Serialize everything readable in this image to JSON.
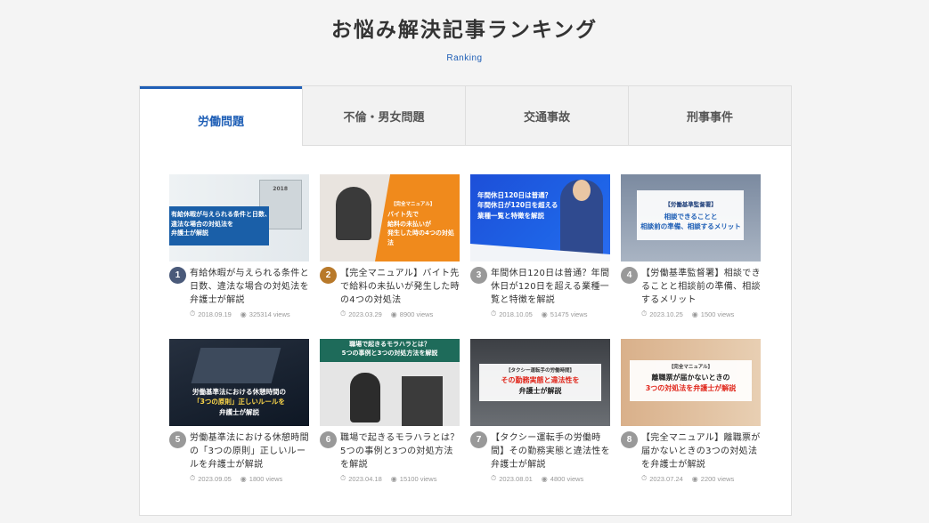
{
  "heading": {
    "title": "お悩み解決記事ランキング",
    "subtitle": "Ranking"
  },
  "tabs": [
    {
      "label": "労働問題",
      "active": true
    },
    {
      "label": "不倫・男女問題",
      "active": false
    },
    {
      "label": "交通事故",
      "active": false
    },
    {
      "label": "刑事事件",
      "active": false
    }
  ],
  "articles": [
    {
      "rank": "1",
      "title": "有給休暇が与えられる条件と日数、違法な場合の対処法を弁護士が解説",
      "date": "2018.09.19",
      "views": "325314 views",
      "thumb_lines": [
        "有給休暇が与えられる条件と日数、",
        "違法な場合の対処法を",
        "弁護士が解説"
      ],
      "thumb_tag": "2018"
    },
    {
      "rank": "2",
      "title": "【完全マニュアル】バイト先で給料の未払いが発生した時の4つの対処法",
      "date": "2023.03.29",
      "views": "8900 views",
      "thumb_lines": [
        "バイト先で",
        "給料の未払いが",
        "発生した時の4つの対処法"
      ],
      "thumb_tag": "【完全マニュアル】"
    },
    {
      "rank": "3",
      "title": "年間休日120日は普通？年間休日が120日を超える業種一覧と特徴を解説",
      "date": "2018.10.05",
      "views": "51475 views",
      "thumb_lines": [
        "年間休日120日は普通？",
        "年間休日が120日を超える",
        "業種一覧と特徴を解説"
      ],
      "thumb_tag": ""
    },
    {
      "rank": "4",
      "title": "【労働基準監督署】相談できることと相談前の準備、相談するメリット",
      "date": "2023.10.25",
      "views": "1500 views",
      "thumb_lines": [
        "相談できることと",
        "相談前の準備、相談するメリット"
      ],
      "thumb_tag": "【労働基準監督署】"
    },
    {
      "rank": "5",
      "title": "労働基準法における休憩時間の「3つの原則」正しいルールを弁護士が解説",
      "date": "2023.09.05",
      "views": "1800 views",
      "thumb_lines": [
        "労働基準法における休憩時間の",
        "「3つの原則」正しいルールを",
        "弁護士が解説"
      ],
      "thumb_tag": ""
    },
    {
      "rank": "6",
      "title": "職場で起きるモラハラとは？5つの事例と3つの対処方法を解説",
      "date": "2023.04.18",
      "views": "15100 views",
      "thumb_lines": [
        "職場で起きるモラハラとは？",
        "5つの事例と3つの対処方法を解説"
      ],
      "thumb_tag": ""
    },
    {
      "rank": "7",
      "title": "【タクシー運転手の労働時間】その勤務実態と違法性を弁護士が解説",
      "date": "2023.08.01",
      "views": "4800 views",
      "thumb_lines": [
        "その勤務実態と違法性を",
        "弁護士が解説"
      ],
      "thumb_tag": "【タクシー運転手の労働時間】"
    },
    {
      "rank": "8",
      "title": "【完全マニュアル】離職票が届かないときの3つの対処法を弁護士が解説",
      "date": "2023.07.24",
      "views": "2200 views",
      "thumb_lines": [
        "離職票が届かないときの",
        "3つの対処法を弁護士が解説"
      ],
      "thumb_tag": "【完全マニュアル】"
    }
  ],
  "colors": {
    "accent": "#1f5fb6",
    "rank1": "#4a5a7a",
    "rank2": "#b8792a",
    "rank_default": "#999999"
  }
}
